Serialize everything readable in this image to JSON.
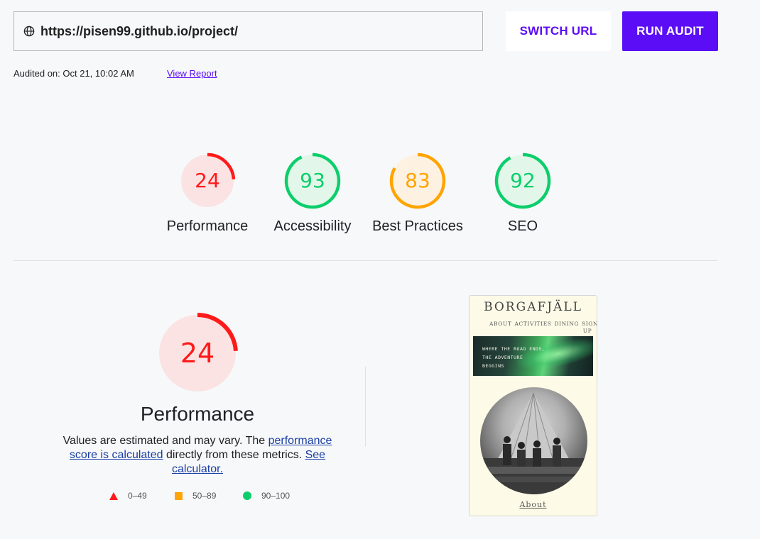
{
  "header": {
    "url": "https://pisen99.github.io/project/",
    "switch_label": "SWITCH URL",
    "run_label": "RUN AUDIT",
    "audited_text": "Audited on: Oct 21, 10:02 AM",
    "view_report_label": "View Report",
    "icon": "globe-icon"
  },
  "gauges": [
    {
      "score": 24,
      "label": "Performance",
      "status": "poor",
      "color": "#ff1a1a",
      "bg": "#fbe3e3"
    },
    {
      "score": 93,
      "label": "Accessibility",
      "status": "good",
      "color": "#0cce6b",
      "bg": "#e2f7ea"
    },
    {
      "score": 83,
      "label": "Best Practices",
      "status": "average",
      "color": "#ffa400",
      "bg": "#fdf1e1"
    },
    {
      "score": 92,
      "label": "SEO",
      "status": "good",
      "color": "#0cce6b",
      "bg": "#e2f7ea"
    }
  ],
  "performance": {
    "score": 24,
    "title": "Performance",
    "desc_prefix": "Values are estimated and may vary. The ",
    "desc_link1": "performance score is calculated",
    "desc_middle": " directly from these metrics. ",
    "desc_link2": "See calculator."
  },
  "legend": [
    {
      "icon": "red-triangle-icon",
      "range": "0–49"
    },
    {
      "icon": "orange-square-icon",
      "range": "50–89"
    },
    {
      "icon": "green-circle-icon",
      "range": "90–100"
    }
  ],
  "thumbnail": {
    "title": "BORGAFJÄLL",
    "nav": [
      "ABOUT",
      "ACTIVITIES",
      "DINING",
      "SIGN UP"
    ],
    "banner_lines": [
      "WHERE THE ROAD ENDS,",
      "THE ADVENTURE",
      "BEGGINS"
    ],
    "about": "About"
  }
}
